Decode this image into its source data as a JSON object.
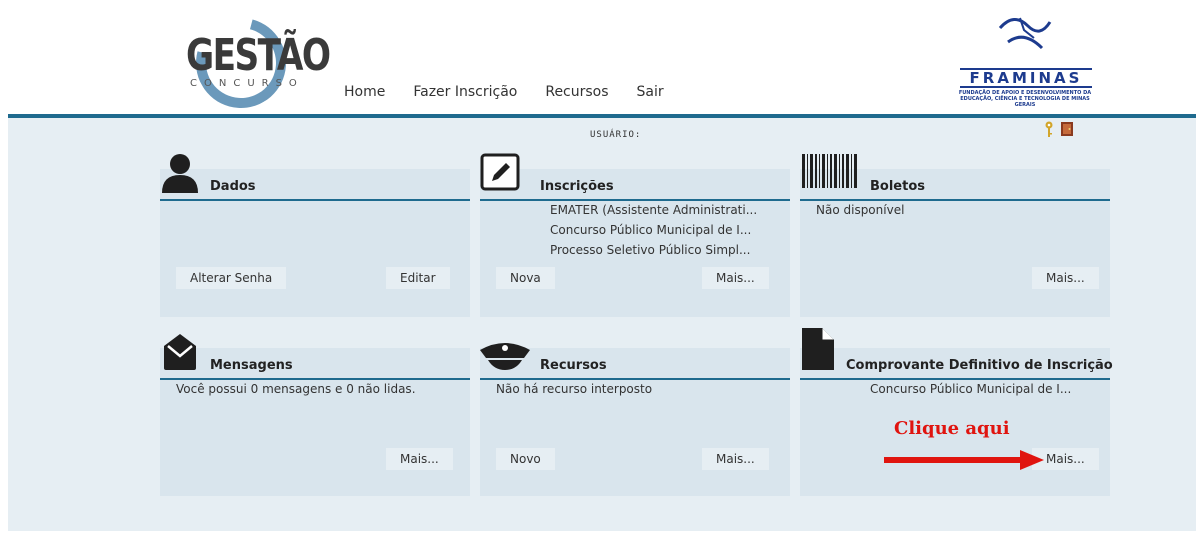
{
  "header": {
    "logo_main": "GESTÃO",
    "logo_sub": "CONCURSO",
    "nav": [
      "Home",
      "Fazer Inscrição",
      "Recursos",
      "Sair"
    ],
    "partner_name": "FRAMINAS",
    "partner_desc": "FUNDAÇÃO DE APOIO E DESENVOLVIMENTO DA EDUCAÇÃO, CIÊNCIA E TECNOLOGIA DE MINAS GERAIS"
  },
  "usuario_label": "USUÁRIO:",
  "cards": {
    "dados": {
      "title": "Dados",
      "btn_left": "Alterar Senha",
      "btn_right": "Editar"
    },
    "inscricoes": {
      "title": "Inscrições",
      "items": [
        "EMATER (Assistente Administrati...",
        "Concurso Público Municipal de I...",
        "Processo Seletivo Público Simpl..."
      ],
      "btn_left": "Nova",
      "btn_right": "Mais..."
    },
    "boletos": {
      "title": "Boletos",
      "text": "Não disponível",
      "btn_right": "Mais..."
    },
    "mensagens": {
      "title": "Mensagens",
      "text": "Você possui 0 mensagens e 0 não lidas.",
      "btn_right": "Mais..."
    },
    "recursos": {
      "title": "Recursos",
      "text": "Não há recurso interposto",
      "btn_left": "Novo",
      "btn_right": "Mais..."
    },
    "comprovante": {
      "title": "Comprovante Definitivo de Inscrição",
      "text": "Concurso Público Municipal de I...",
      "btn_right": "Mais..."
    }
  },
  "annotation": {
    "text": "Clique aqui",
    "color": "#e0140f"
  },
  "colors": {
    "accent": "#1e6a8e",
    "panel": "#d9e5ed",
    "background": "#e6eef3"
  }
}
